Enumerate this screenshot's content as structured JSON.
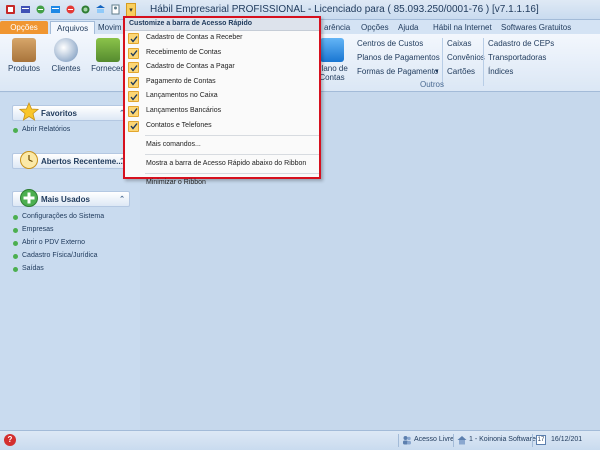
{
  "window": {
    "title": "Hábil Empresarial PROFISSIONAL - Licenciado para  ( 85.093.250/0001-76 ) [v7.1.1.16]"
  },
  "qat": {
    "dropdown_glyph": "▾"
  },
  "tabs": {
    "opcoes_file": "Opções",
    "arquivos": "Arquivos",
    "movim": "Movim",
    "arencia": "arência",
    "opcoes": "Opções",
    "ajuda": "Ajuda",
    "habil_internet": "Hábil na Internet",
    "softwares": "Softwares Gratuitos"
  },
  "ribbon": {
    "produtos": "Produtos",
    "clientes": "Clientes",
    "fornecedores": "Forneced",
    "plano_contas_1": "Plano de",
    "plano_contas_2": "Contas",
    "centros_custos": "Centros de Custos",
    "planos_pagamentos": "Planos de Pagamentos",
    "formas_pagamento": "Formas de Pagamento",
    "caixas": "Caixas",
    "convenios": "Convênios",
    "cartoes": "Cartões",
    "cadastro_ceps": "Cadastro de CEPs",
    "transportadoras": "Transportadoras",
    "indices": "Índices",
    "outros_group": "Outros"
  },
  "menu": {
    "header": "Customize a barra de Acesso Rápido",
    "checked_items": [
      "Cadastro de Contas a Receber",
      "Recebimento de Contas",
      "Cadastro de Contas a Pagar",
      "Pagamento de Contas",
      "Lançamentos no Caixa",
      "Lançamentos Bancários",
      "Contatos e Telefones"
    ],
    "mais_comandos": "Mais comandos...",
    "mostrar_abaixo": "Mostra a barra de Acesso Rápido abaixo do Ribbon",
    "minimizar": "Minimizar o Ribbon"
  },
  "sidebar": {
    "favoritos": {
      "title": "Favoritos",
      "items": [
        "Abrir Relatórios"
      ]
    },
    "abertos": {
      "title": "Abertos Recenteme..."
    },
    "mais_usados": {
      "title": "Mais Usados",
      "items": [
        "Configurações do Sistema",
        "Empresas",
        "Abrir o PDV Externo",
        "Cadastro Física/Jurídica",
        "Saídas"
      ]
    },
    "splitter_glyph": "⋮"
  },
  "status": {
    "help": "?",
    "acesso": "Acesso Livre",
    "empresa": "1 - Koinonia Software",
    "calendar_day": "17",
    "data": "16/12/201"
  },
  "colors": {
    "accent_orange": "#f09631",
    "menu_border": "#d6101e",
    "check_fill": "#fcd675",
    "background": "#c6d8ec"
  }
}
